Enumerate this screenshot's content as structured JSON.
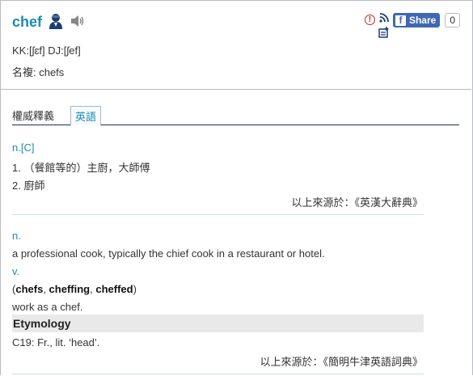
{
  "entry": {
    "word": "chef",
    "pronunciation": "KK:[ʃɛf] DJ:[ʃef]",
    "plural": "名複: chefs"
  },
  "toolbar": {
    "report_symbol": "!",
    "share_label": "Share",
    "share_count": "0"
  },
  "tabs": {
    "section_label": "權威釋義",
    "active_tab": "英語"
  },
  "dict1": {
    "pos": "n.[C]",
    "senses": [
      "1. （餐館等的）主廚，大師傅",
      "2. 廚師"
    ],
    "source": "以上來源於：《英漢大辭典》"
  },
  "dict2": {
    "noun_pos": "n.",
    "noun_def": "a professional cook, typically the chief cook in a restaurant or hotel.",
    "verb_pos": "v.",
    "verb_forms": [
      "chefs",
      "cheffing",
      "cheffed"
    ],
    "verb_def": "work as a chef.",
    "etymology_title": "Etymology",
    "etymology_text": "C19: Fr., lit. ‘head’.",
    "source": "以上來源於：《簡明牛津英語詞典》"
  }
}
